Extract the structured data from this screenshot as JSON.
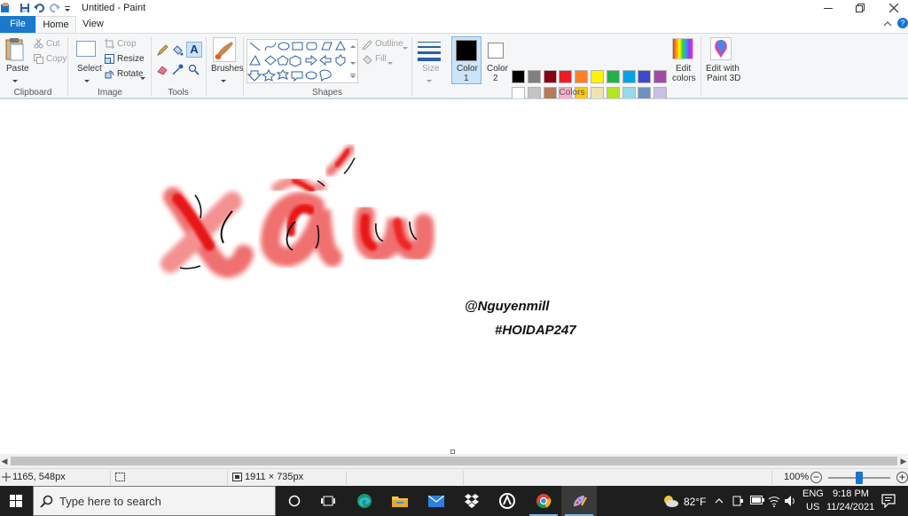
{
  "window": {
    "title": "Untitled - Paint"
  },
  "tabs": {
    "file": "File",
    "home": "Home",
    "view": "View"
  },
  "ribbon": {
    "clipboard": {
      "label": "Clipboard",
      "paste": "Paste",
      "cut": "Cut",
      "copy": "Copy"
    },
    "image": {
      "label": "Image",
      "select": "Select",
      "crop": "Crop",
      "resize": "Resize",
      "rotate": "Rotate"
    },
    "tools": {
      "label": "Tools"
    },
    "brushes": {
      "label": "Brushes"
    },
    "shapes": {
      "label": "Shapes",
      "outline": "Outline",
      "fill": "Fill"
    },
    "size": {
      "label": "Size"
    },
    "color1": {
      "line1": "Color",
      "line2": "1",
      "value": "#000000"
    },
    "color2": {
      "line1": "Color",
      "line2": "2",
      "value": "#ffffff"
    },
    "colors": {
      "label": "Colors",
      "palette": [
        "#000000",
        "#7f7f7f",
        "#880015",
        "#ed1c24",
        "#ff7f27",
        "#fff200",
        "#22b14c",
        "#00a2e8",
        "#3f48cc",
        "#a349a4",
        "#ffffff",
        "#c3c3c3",
        "#b97a57",
        "#ffaec9",
        "#ffc90e",
        "#efe4b0",
        "#b5e61d",
        "#99d9ea",
        "#7092be",
        "#c8bfe7",
        "#f06868",
        "#ee4444",
        "#ff2020",
        "#ee1111",
        "#dd0000",
        "#ffb8b8",
        "#ffd8d8",
        "#ffffff",
        "#ffffff",
        "#ffffff"
      ]
    },
    "edit_colors": {
      "line1": "Edit",
      "line2": "colors"
    },
    "paint3d": {
      "line1": "Edit with",
      "line2": "Paint 3D"
    }
  },
  "canvas": {
    "signature_1": "@Nguyenmill",
    "signature_2": "#HOIDAP247"
  },
  "statusbar": {
    "cursor_pos": "1165, 548px",
    "canvas_size": "1911 × 735px",
    "zoom": "100%"
  },
  "taskbar": {
    "search_placeholder": "Type here to search",
    "weather": "82°F",
    "lang_top": "ENG",
    "lang_bottom": "US",
    "time": "9:18 PM",
    "date": "11/24/2021"
  }
}
